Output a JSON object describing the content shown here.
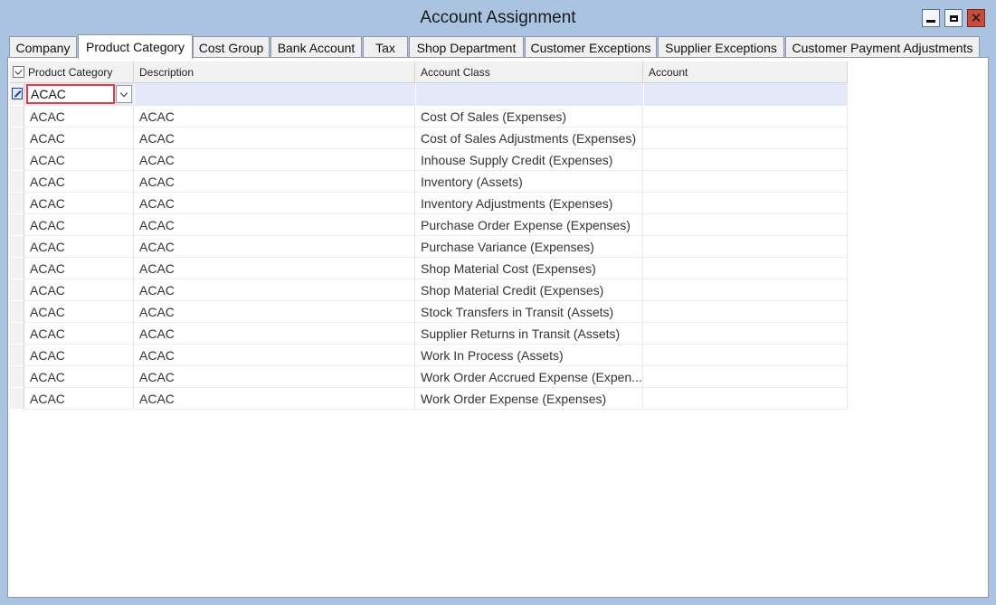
{
  "window": {
    "title": "Account Assignment"
  },
  "tabs": [
    {
      "label": "Company",
      "active": false
    },
    {
      "label": "Product Category",
      "active": true
    },
    {
      "label": "Cost Group",
      "active": false
    },
    {
      "label": "Bank Account",
      "active": false
    },
    {
      "label": "Tax",
      "active": false
    },
    {
      "label": "Shop Department",
      "active": false
    },
    {
      "label": "Customer Exceptions",
      "active": false
    },
    {
      "label": "Supplier Exceptions",
      "active": false
    },
    {
      "label": "Customer Payment Adjustments",
      "active": false
    }
  ],
  "grid": {
    "columns": [
      "Product Category",
      "Description",
      "Account Class",
      "Account"
    ],
    "filter": {
      "product_category_value": "ACAC"
    },
    "rows": [
      {
        "product_category": "ACAC",
        "description": "ACAC",
        "account_class": "Cost Of Sales (Expenses)",
        "account": ""
      },
      {
        "product_category": "ACAC",
        "description": "ACAC",
        "account_class": "Cost of Sales Adjustments (Expenses)",
        "account": ""
      },
      {
        "product_category": "ACAC",
        "description": "ACAC",
        "account_class": "Inhouse Supply Credit (Expenses)",
        "account": ""
      },
      {
        "product_category": "ACAC",
        "description": "ACAC",
        "account_class": "Inventory (Assets)",
        "account": ""
      },
      {
        "product_category": "ACAC",
        "description": "ACAC",
        "account_class": "Inventory Adjustments (Expenses)",
        "account": ""
      },
      {
        "product_category": "ACAC",
        "description": "ACAC",
        "account_class": "Purchase Order Expense (Expenses)",
        "account": ""
      },
      {
        "product_category": "ACAC",
        "description": "ACAC",
        "account_class": "Purchase Variance (Expenses)",
        "account": ""
      },
      {
        "product_category": "ACAC",
        "description": "ACAC",
        "account_class": "Shop Material Cost (Expenses)",
        "account": ""
      },
      {
        "product_category": "ACAC",
        "description": "ACAC",
        "account_class": "Shop Material Credit (Expenses)",
        "account": ""
      },
      {
        "product_category": "ACAC",
        "description": "ACAC",
        "account_class": "Stock Transfers in Transit (Assets)",
        "account": ""
      },
      {
        "product_category": "ACAC",
        "description": "ACAC",
        "account_class": "Supplier Returns in Transit (Assets)",
        "account": ""
      },
      {
        "product_category": "ACAC",
        "description": "ACAC",
        "account_class": "Work In Process (Assets)",
        "account": ""
      },
      {
        "product_category": "ACAC",
        "description": "ACAC",
        "account_class": "Work Order Accrued Expense (Expen...",
        "account": ""
      },
      {
        "product_category": "ACAC",
        "description": "ACAC",
        "account_class": "Work Order Expense (Expenses)",
        "account": ""
      }
    ]
  }
}
